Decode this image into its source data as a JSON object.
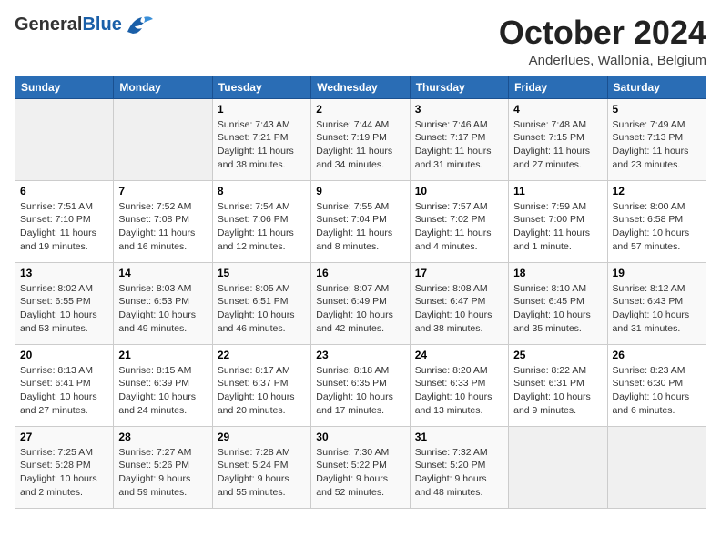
{
  "header": {
    "logo_general": "General",
    "logo_blue": "Blue",
    "month_title": "October 2024",
    "subtitle": "Anderlues, Wallonia, Belgium"
  },
  "days_of_week": [
    "Sunday",
    "Monday",
    "Tuesday",
    "Wednesday",
    "Thursday",
    "Friday",
    "Saturday"
  ],
  "weeks": [
    [
      {
        "day": "",
        "info": ""
      },
      {
        "day": "",
        "info": ""
      },
      {
        "day": "1",
        "info": "Sunrise: 7:43 AM\nSunset: 7:21 PM\nDaylight: 11 hours\nand 38 minutes."
      },
      {
        "day": "2",
        "info": "Sunrise: 7:44 AM\nSunset: 7:19 PM\nDaylight: 11 hours\nand 34 minutes."
      },
      {
        "day": "3",
        "info": "Sunrise: 7:46 AM\nSunset: 7:17 PM\nDaylight: 11 hours\nand 31 minutes."
      },
      {
        "day": "4",
        "info": "Sunrise: 7:48 AM\nSunset: 7:15 PM\nDaylight: 11 hours\nand 27 minutes."
      },
      {
        "day": "5",
        "info": "Sunrise: 7:49 AM\nSunset: 7:13 PM\nDaylight: 11 hours\nand 23 minutes."
      }
    ],
    [
      {
        "day": "6",
        "info": "Sunrise: 7:51 AM\nSunset: 7:10 PM\nDaylight: 11 hours\nand 19 minutes."
      },
      {
        "day": "7",
        "info": "Sunrise: 7:52 AM\nSunset: 7:08 PM\nDaylight: 11 hours\nand 16 minutes."
      },
      {
        "day": "8",
        "info": "Sunrise: 7:54 AM\nSunset: 7:06 PM\nDaylight: 11 hours\nand 12 minutes."
      },
      {
        "day": "9",
        "info": "Sunrise: 7:55 AM\nSunset: 7:04 PM\nDaylight: 11 hours\nand 8 minutes."
      },
      {
        "day": "10",
        "info": "Sunrise: 7:57 AM\nSunset: 7:02 PM\nDaylight: 11 hours\nand 4 minutes."
      },
      {
        "day": "11",
        "info": "Sunrise: 7:59 AM\nSunset: 7:00 PM\nDaylight: 11 hours\nand 1 minute."
      },
      {
        "day": "12",
        "info": "Sunrise: 8:00 AM\nSunset: 6:58 PM\nDaylight: 10 hours\nand 57 minutes."
      }
    ],
    [
      {
        "day": "13",
        "info": "Sunrise: 8:02 AM\nSunset: 6:55 PM\nDaylight: 10 hours\nand 53 minutes."
      },
      {
        "day": "14",
        "info": "Sunrise: 8:03 AM\nSunset: 6:53 PM\nDaylight: 10 hours\nand 49 minutes."
      },
      {
        "day": "15",
        "info": "Sunrise: 8:05 AM\nSunset: 6:51 PM\nDaylight: 10 hours\nand 46 minutes."
      },
      {
        "day": "16",
        "info": "Sunrise: 8:07 AM\nSunset: 6:49 PM\nDaylight: 10 hours\nand 42 minutes."
      },
      {
        "day": "17",
        "info": "Sunrise: 8:08 AM\nSunset: 6:47 PM\nDaylight: 10 hours\nand 38 minutes."
      },
      {
        "day": "18",
        "info": "Sunrise: 8:10 AM\nSunset: 6:45 PM\nDaylight: 10 hours\nand 35 minutes."
      },
      {
        "day": "19",
        "info": "Sunrise: 8:12 AM\nSunset: 6:43 PM\nDaylight: 10 hours\nand 31 minutes."
      }
    ],
    [
      {
        "day": "20",
        "info": "Sunrise: 8:13 AM\nSunset: 6:41 PM\nDaylight: 10 hours\nand 27 minutes."
      },
      {
        "day": "21",
        "info": "Sunrise: 8:15 AM\nSunset: 6:39 PM\nDaylight: 10 hours\nand 24 minutes."
      },
      {
        "day": "22",
        "info": "Sunrise: 8:17 AM\nSunset: 6:37 PM\nDaylight: 10 hours\nand 20 minutes."
      },
      {
        "day": "23",
        "info": "Sunrise: 8:18 AM\nSunset: 6:35 PM\nDaylight: 10 hours\nand 17 minutes."
      },
      {
        "day": "24",
        "info": "Sunrise: 8:20 AM\nSunset: 6:33 PM\nDaylight: 10 hours\nand 13 minutes."
      },
      {
        "day": "25",
        "info": "Sunrise: 8:22 AM\nSunset: 6:31 PM\nDaylight: 10 hours\nand 9 minutes."
      },
      {
        "day": "26",
        "info": "Sunrise: 8:23 AM\nSunset: 6:30 PM\nDaylight: 10 hours\nand 6 minutes."
      }
    ],
    [
      {
        "day": "27",
        "info": "Sunrise: 7:25 AM\nSunset: 5:28 PM\nDaylight: 10 hours\nand 2 minutes."
      },
      {
        "day": "28",
        "info": "Sunrise: 7:27 AM\nSunset: 5:26 PM\nDaylight: 9 hours\nand 59 minutes."
      },
      {
        "day": "29",
        "info": "Sunrise: 7:28 AM\nSunset: 5:24 PM\nDaylight: 9 hours\nand 55 minutes."
      },
      {
        "day": "30",
        "info": "Sunrise: 7:30 AM\nSunset: 5:22 PM\nDaylight: 9 hours\nand 52 minutes."
      },
      {
        "day": "31",
        "info": "Sunrise: 7:32 AM\nSunset: 5:20 PM\nDaylight: 9 hours\nand 48 minutes."
      },
      {
        "day": "",
        "info": ""
      },
      {
        "day": "",
        "info": ""
      }
    ]
  ]
}
